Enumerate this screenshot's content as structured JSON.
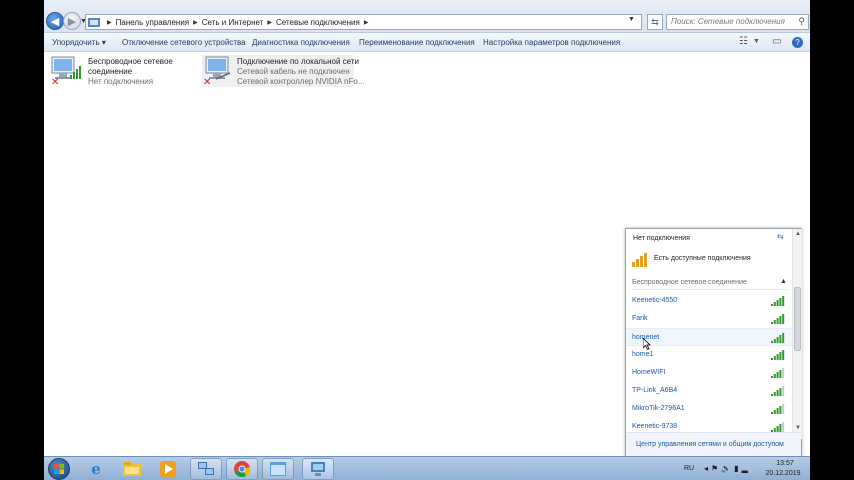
{
  "address_bar": {
    "breadcrumb": [
      "Панель управления",
      "Сеть и Интернет",
      "Сетевые подключения"
    ],
    "search_placeholder": "Поиск: Сетевые подключения"
  },
  "toolbar": {
    "organize": "Упорядочить ▾",
    "disable_device": "Отключение сетевого устройства",
    "diagnose": "Диагностика подключения",
    "rename": "Переименование подключения",
    "settings": "Настройка параметров подключения"
  },
  "connections": [
    {
      "name_line1": "Беспроводное сетевое",
      "name_line2": "соединение",
      "status": "Нет подключения",
      "icon": "wireless-pc-icon"
    },
    {
      "name_line1": "Подключение по локальной сети",
      "status": "Сетевой кабель не подключен",
      "device": "Сетевой контроллер NVIDIA nFo...",
      "icon": "lan-pc-icon"
    }
  ],
  "wifi_popup": {
    "header": "Нет подключения",
    "available": "Есть доступные подключения",
    "section": "Беспроводное сетевое соединение",
    "networks": [
      {
        "name": "Keenetic-4550",
        "signal": 5
      },
      {
        "name": "Farik",
        "signal": 5
      },
      {
        "name": "homenet",
        "signal": 5
      },
      {
        "name": "home1",
        "signal": 5
      },
      {
        "name": "HomeWIFI",
        "signal": 4
      },
      {
        "name": "TP-Link_A6B4",
        "signal": 4
      },
      {
        "name": "MikroTik-2796A1",
        "signal": 4
      },
      {
        "name": "Keenetic-9738",
        "signal": 4
      }
    ],
    "footer_link": "Центр управления сетями и общим доступом"
  },
  "taskbar": {
    "language": "RU",
    "time": "13:57",
    "date": "20.12.2019",
    "apps": [
      "ie-icon",
      "explorer-icon",
      "media-player-icon",
      "network-icon",
      "chrome-icon",
      "generic-window-icon",
      "network-connections-icon"
    ]
  },
  "colors": {
    "link": "#1a5aa6",
    "signal": "#2f9a2f",
    "accent": "#3a6ea5"
  }
}
